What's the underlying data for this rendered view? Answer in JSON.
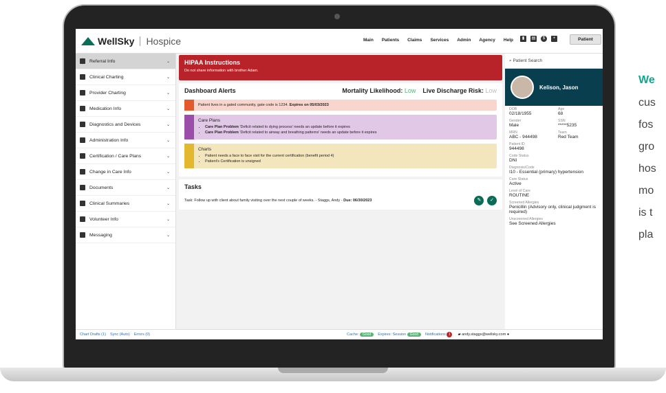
{
  "app": {
    "brand": "WellSky",
    "product": "Hospice"
  },
  "nav": {
    "items": [
      "Main",
      "Patients",
      "Claims",
      "Services",
      "Admin",
      "Agency",
      "Help"
    ],
    "patient_button": "Patient"
  },
  "sidebar": {
    "items": [
      {
        "label": "Referral Info",
        "icon": "clipboard-icon"
      },
      {
        "label": "Clinical Charting",
        "icon": "clipboard-icon"
      },
      {
        "label": "Provider Charting",
        "icon": "chart-icon"
      },
      {
        "label": "Medication Info",
        "icon": "pill-icon"
      },
      {
        "label": "Diagnostics and Devices",
        "icon": "chart-icon"
      },
      {
        "label": "Administration Info",
        "icon": "people-icon"
      },
      {
        "label": "Certification / Care Plans",
        "icon": "chart-icon"
      },
      {
        "label": "Change in Care Info",
        "icon": "person-icon"
      },
      {
        "label": "Documents",
        "icon": "document-icon"
      },
      {
        "label": "Clinical Summaries",
        "icon": "summary-icon"
      },
      {
        "label": "Volunteer Info",
        "icon": "id-card-icon"
      },
      {
        "label": "Messaging",
        "icon": "message-icon"
      }
    ]
  },
  "hipaa": {
    "title": "HIPAA Instructions",
    "text": "Do not share information with brother Adam."
  },
  "alerts": {
    "title": "Dashboard Alerts",
    "mortality_label": "Mortality Likelihood:",
    "mortality_value": "Low",
    "discharge_label": "Live Discharge Risk:",
    "discharge_value": "Low",
    "gate": {
      "text": "Patient lives in a gated community, gate code is 1234.",
      "expires": "Expires on 05/03/2023"
    },
    "care_plans": {
      "title": "Care Plans",
      "items": [
        {
          "bold": "Care Plan Problem",
          "text": "'Deficit related to dying process' needs an update before it expires"
        },
        {
          "bold": "Care Plan Problem",
          "text": "'Deficit related to airway and breathing patterns' needs an update before it expires"
        }
      ]
    },
    "charts": {
      "title": "Charts",
      "items": [
        "Patient needs a face to face visit for the current certification (benefit period 4)",
        "Patient's Certification is unsigned"
      ]
    }
  },
  "tasks": {
    "title": "Tasks",
    "text": "Task: Follow up with client about family visiting over the next couple of weeks. - Staggs, Andy -",
    "due": "Due: 06/30/2023"
  },
  "patient": {
    "search_placeholder": "Patient Search",
    "name": "Kelison, Jason",
    "fields": [
      {
        "label": "DOB",
        "value": "02/18/1955"
      },
      {
        "label": "Age",
        "value": "68"
      },
      {
        "label": "Gender",
        "value": "Male"
      },
      {
        "label": "SSN",
        "value": "*****5235"
      },
      {
        "label": "MRN",
        "value": "ABC - 944498"
      },
      {
        "label": "Team",
        "value": "Red Team"
      }
    ],
    "single": [
      {
        "label": "Patient ID",
        "value": "944498"
      },
      {
        "label": "Code Status",
        "value": "DNI"
      },
      {
        "label": "Diagnosis/Code",
        "value": "I10 - Essential (primary) hypertension"
      },
      {
        "label": "Care Status",
        "value": "Active"
      },
      {
        "label": "Level of Care",
        "value": "ROUTINE"
      },
      {
        "label": "Screened Allergies",
        "value": "Penicillin (Advisory only, clinical judgment is required)"
      },
      {
        "label": "Unscreened Allergies",
        "value": "See Screened Allergies"
      }
    ]
  },
  "statusbar": {
    "chart_drafts": "Chart Drafts",
    "chart_drafts_count": "1",
    "sync": "Sync",
    "sync_value": "Auto",
    "errors": "Errors",
    "errors_count": "0",
    "cache": "Cache:",
    "cache_value": "Good",
    "expires": "Expires:",
    "session": "Session",
    "session_value": "Good",
    "notifications": "Notifications",
    "notifications_count": "1",
    "user": "andy.staggs@wellsky.com"
  },
  "side_text": [
    "We",
    "cus",
    "fos",
    "gro",
    "hos",
    "mo",
    "is t",
    "pla"
  ]
}
